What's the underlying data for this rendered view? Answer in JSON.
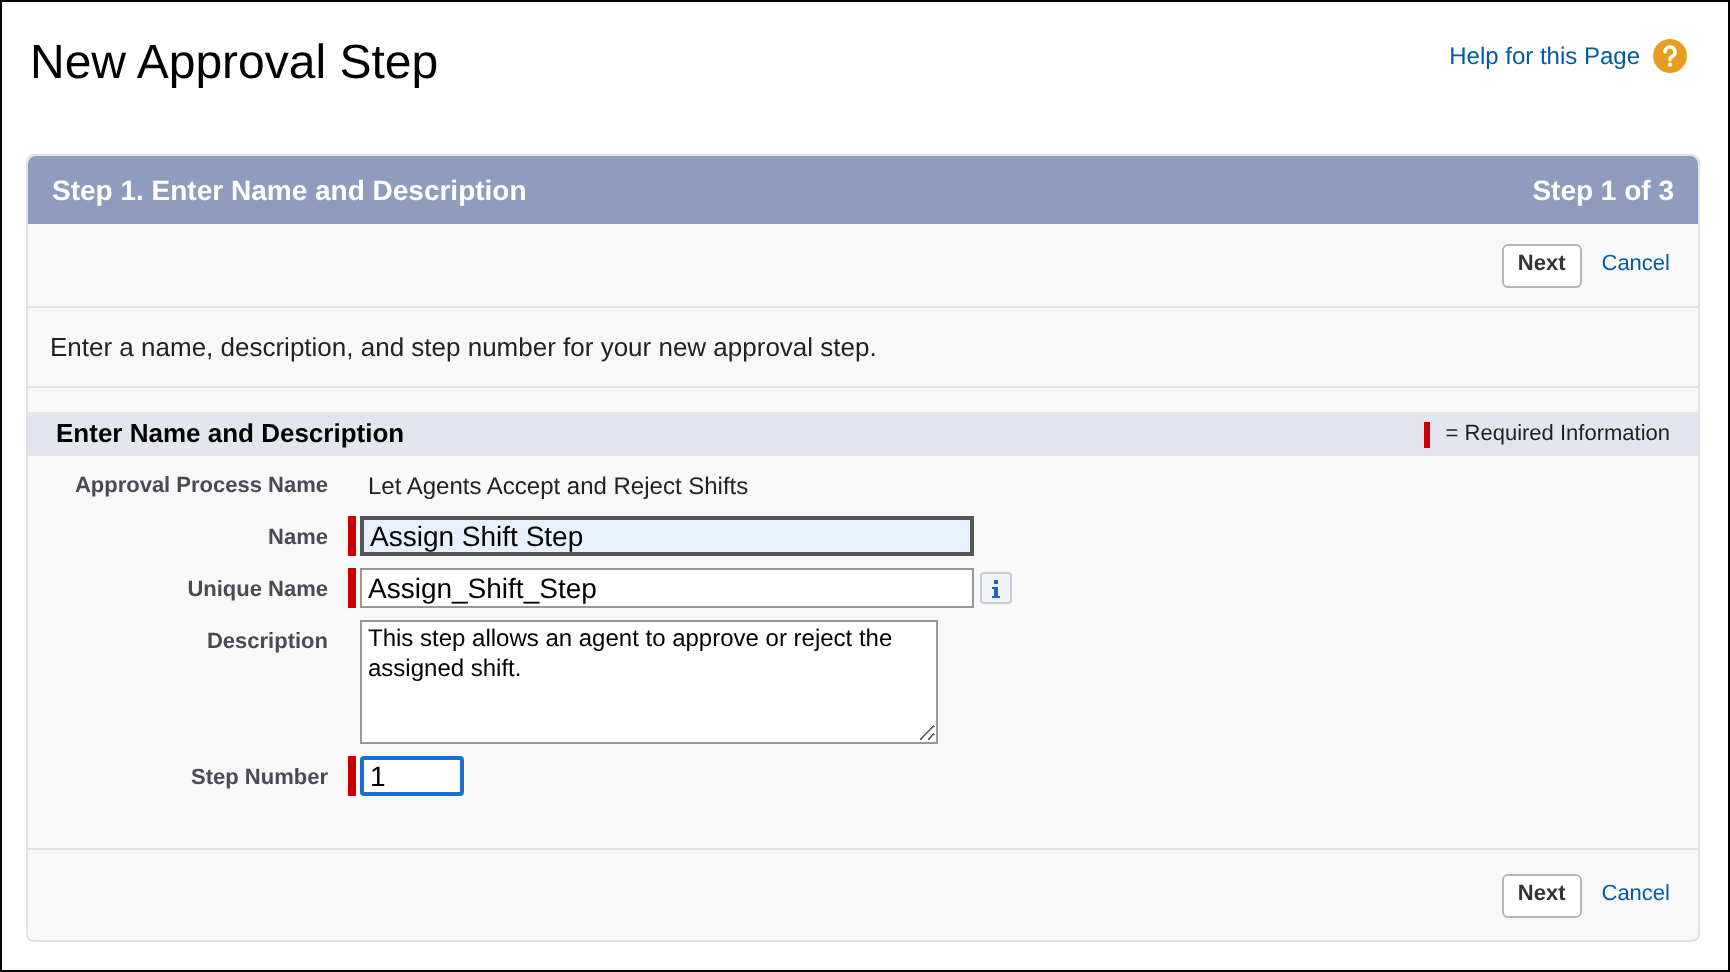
{
  "page_title": "New Approval Step",
  "help_link": "Help for this Page",
  "wizard": {
    "title": "Step 1. Enter Name and Description",
    "step_indicator": "Step 1 of 3"
  },
  "top_buttons": {
    "next": "Next",
    "cancel": "Cancel"
  },
  "instructions": "Enter a name, description, and step number for your new approval step.",
  "section": {
    "title": "Enter Name and Description",
    "legend": "= Required Information"
  },
  "fields": [
    {
      "label": "Approval Process Name",
      "kind": "static",
      "value": "Let Agents Accept and Reject Shifts",
      "required": false
    },
    {
      "label": "Name",
      "kind": "text",
      "value": "Assign Shift Step",
      "required": true,
      "autofilled": true
    },
    {
      "label": "Unique Name",
      "kind": "text",
      "value": "Assign_Shift_Step",
      "required": true,
      "info": true
    },
    {
      "label": "Description",
      "kind": "textarea",
      "value": "This step allows an agent to approve or reject the assigned shift.",
      "required": false
    },
    {
      "label": "Step Number",
      "kind": "short",
      "value": "1",
      "required": true,
      "focused": true
    }
  ],
  "bottom_buttons": {
    "next": "Next",
    "cancel": "Cancel"
  }
}
